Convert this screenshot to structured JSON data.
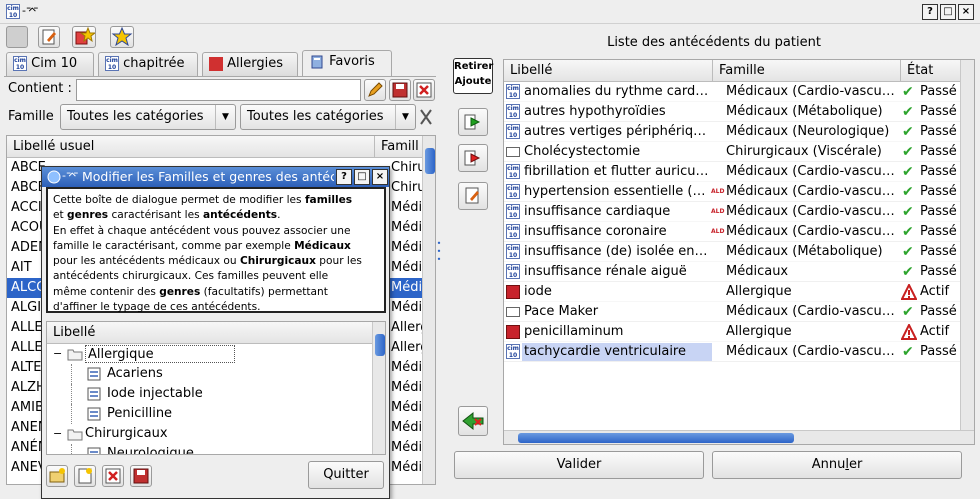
{
  "window": {
    "app_icon": "cim10-icon",
    "title_pin": "-⌤"
  },
  "titlebar_buttons": [
    "?",
    "□",
    "×"
  ],
  "tabs": [
    {
      "label": "Cim 10",
      "icon": "cim10-icon"
    },
    {
      "label": "chapitrée",
      "icon": "cim10-icon"
    },
    {
      "label": "Allergies",
      "icon": "allergy-icon"
    },
    {
      "label": "Favoris",
      "icon": "book-icon"
    }
  ],
  "search": {
    "label": "Contient :",
    "value": ""
  },
  "famille": {
    "label": "Famille",
    "combo1": "Toutes les catégories",
    "combo2": "Toutes les catégories"
  },
  "left_table": {
    "col1": "Libellé usuel",
    "col2": "Famill",
    "rows": [
      {
        "c1": "ABCE",
        "c2": "Chiru"
      },
      {
        "c1": "ABCE",
        "c2": "Chiru"
      },
      {
        "c1": "ACCI",
        "c2": "Médica"
      },
      {
        "c1": "ACOU",
        "c2": "Médica"
      },
      {
        "c1": "ADEN",
        "c2": "Médica"
      },
      {
        "c1": "AIT",
        "c2": "Médica"
      },
      {
        "c1": "ALCO",
        "c2": "Médica"
      },
      {
        "c1": "ALGI",
        "c2": "Médica"
      },
      {
        "c1": "ALLE",
        "c2": "Allerg"
      },
      {
        "c1": "ALLE",
        "c2": "Allerg"
      },
      {
        "c1": "ALTE",
        "c2": "Médica"
      },
      {
        "c1": "ALZH",
        "c2": "Médica"
      },
      {
        "c1": "AMIB",
        "c2": "Médica"
      },
      {
        "c1": "ANEN",
        "c2": "Médica"
      },
      {
        "c1": "ANÉM",
        "c2": "Médica"
      },
      {
        "c1": "ANEV",
        "c2": "Médica"
      }
    ]
  },
  "dialog": {
    "title": "Modifier les Familles et genres des antécédents",
    "help_lines": [
      [
        {
          "t": "Cette boîte de dialogue permet de modifier les "
        },
        {
          "t": "familles",
          "b": true
        }
      ],
      [
        {
          "t": "et "
        },
        {
          "t": "genres",
          "b": true
        },
        {
          "t": " caractérisant les "
        },
        {
          "t": "antécédents",
          "b": true
        },
        {
          "t": "."
        }
      ],
      [
        {
          "t": "En effet à chaque antécédent vous pouvez associer une"
        }
      ],
      [
        {
          "t": "famille le caractérisant, comme par exemple "
        },
        {
          "t": "Médicaux",
          "b": true
        }
      ],
      [
        {
          "t": "pour les antécédents médicaux ou "
        },
        {
          "t": "Chirurgicaux",
          "b": true
        },
        {
          "t": " pour les"
        }
      ],
      [
        {
          "t": "antécédents chirurgicaux. Ces familles peuvent elle"
        }
      ],
      [
        {
          "t": "même contenir des "
        },
        {
          "t": "genres",
          "b": true
        },
        {
          "t": " (facultatifs) permettant"
        }
      ],
      [
        {
          "t": "d'affiner le typage de ces antécédents."
        }
      ]
    ],
    "tree_header": "Libellé",
    "tree": [
      {
        "label": "Allergique",
        "level": 0,
        "type": "folder",
        "expander": "−"
      },
      {
        "label": "Acariens",
        "level": 1,
        "type": "doc"
      },
      {
        "label": "Iode injectable",
        "level": 1,
        "type": "doc"
      },
      {
        "label": "Penicilline",
        "level": 1,
        "type": "doc"
      },
      {
        "label": "Chirurgicaux",
        "level": 0,
        "type": "folder",
        "expander": "−"
      },
      {
        "label": "Neurologique",
        "level": 1,
        "type": "doc"
      }
    ],
    "quit_label": "Quitter"
  },
  "right": {
    "title": "Liste des antécédents du patient",
    "retire_ajoute": [
      "Retirer",
      "Ajoute"
    ],
    "columns": [
      "Libellé",
      "Famille",
      "État"
    ],
    "rows": [
      {
        "icon": "cim",
        "ald": false,
        "label": "anomalies du rythme card…",
        "famille": "Médicaux (Cardio-vascu…",
        "etat": "Passé",
        "etat_icon": "check"
      },
      {
        "icon": "cim",
        "ald": false,
        "label": "autres hypothyroïdies",
        "famille": "Médicaux (Métabolique)",
        "etat": "Passé",
        "etat_icon": "check"
      },
      {
        "icon": "cim",
        "ald": false,
        "label": "autres vertiges périphériq…",
        "famille": "Médicaux (Neurologique)",
        "etat": "Passé",
        "etat_icon": "check"
      },
      {
        "icon": "doc",
        "ald": false,
        "label": "Cholécystectomie",
        "famille": "Chirurgicaux (Viscérale)",
        "etat": "Passé",
        "etat_icon": "check"
      },
      {
        "icon": "cim",
        "ald": false,
        "label": "fibrillation et flutter auricu…",
        "famille": "Médicaux (Cardio-vascu…",
        "etat": "Passé",
        "etat_icon": "check"
      },
      {
        "icon": "cim",
        "ald": true,
        "label": "hypertension essentielle (…",
        "famille": "Médicaux (Cardio-vascu…",
        "etat": "Passé",
        "etat_icon": "check"
      },
      {
        "icon": "cim",
        "ald": true,
        "label": "insuffisance cardiaque",
        "famille": "Médicaux (Cardio-vascu…",
        "etat": "Passé",
        "etat_icon": "check"
      },
      {
        "icon": "cim",
        "ald": true,
        "label": "insuffisance coronaire",
        "famille": "Médicaux (Cardio-vascu…",
        "etat": "Passé",
        "etat_icon": "check"
      },
      {
        "icon": "cim",
        "ald": false,
        "label": "insuffisance (de) isolée en…",
        "famille": "Médicaux (Métabolique)",
        "etat": "Passé",
        "etat_icon": "check"
      },
      {
        "icon": "cim",
        "ald": false,
        "label": "insuffisance rénale aiguë",
        "famille": "Médicaux",
        "etat": "Passé",
        "etat_icon": "check"
      },
      {
        "icon": "allergy",
        "ald": false,
        "label": "iode",
        "famille": "Allergique",
        "etat": "Actif",
        "etat_icon": "warning"
      },
      {
        "icon": "doc",
        "ald": false,
        "label": "Pace Maker",
        "famille": "Médicaux (Cardio-vascu…",
        "etat": "Passé",
        "etat_icon": "check"
      },
      {
        "icon": "allergy",
        "ald": false,
        "label": "penicillaminum",
        "famille": "Allergique",
        "etat": "Actif",
        "etat_icon": "warning"
      },
      {
        "icon": "cim",
        "ald": false,
        "label": "tachycardie ventriculaire",
        "famille": "Médicaux (Cardio-vascu…",
        "etat": "Passé",
        "etat_icon": "check",
        "selected": true
      }
    ],
    "valider": "Valider",
    "annuler_pre": "Annu",
    "annuler_u": "l",
    "annuler_post": "er"
  },
  "ald_label": "ALD",
  "cim_text": "cim\n10",
  "colors": {
    "selection": "#2c64c8",
    "check": "#2da42d",
    "warning": "#c82020",
    "ald": "#c8232b"
  }
}
